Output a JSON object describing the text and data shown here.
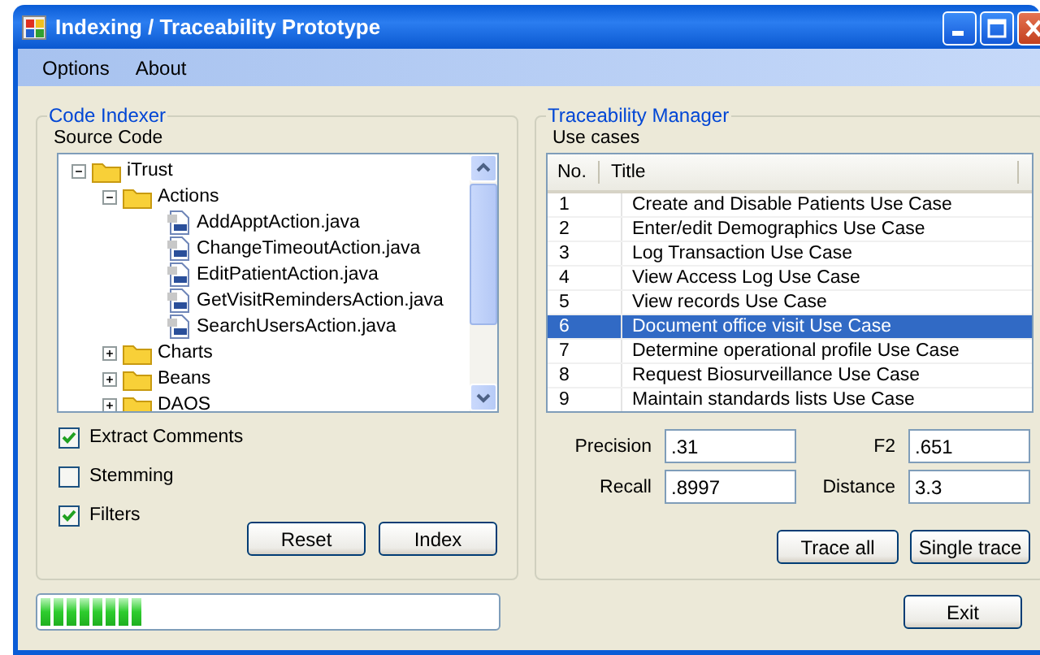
{
  "window": {
    "title": "Indexing / Traceability Prototype"
  },
  "menu": [
    "Options",
    "About"
  ],
  "code_indexer": {
    "title": "Code Indexer",
    "source_label": "Source Code",
    "tree": [
      {
        "label": "iTrust",
        "kind": "folder",
        "expanded": true,
        "children": [
          {
            "label": "Actions",
            "kind": "folder",
            "expanded": true,
            "children": [
              {
                "label": "AddApptAction.java",
                "kind": "file"
              },
              {
                "label": "ChangeTimeoutAction.java",
                "kind": "file"
              },
              {
                "label": "EditPatientAction.java",
                "kind": "file"
              },
              {
                "label": "GetVisitRemindersAction.java",
                "kind": "file"
              },
              {
                "label": "SearchUsersAction.java",
                "kind": "file"
              }
            ]
          },
          {
            "label": "Charts",
            "kind": "folder",
            "expanded": false
          },
          {
            "label": "Beans",
            "kind": "folder",
            "expanded": false
          },
          {
            "label": "DAOS",
            "kind": "folder",
            "expanded": false
          }
        ]
      }
    ],
    "options": [
      {
        "label": "Extract Comments",
        "checked": true
      },
      {
        "label": "Stemming",
        "checked": false
      },
      {
        "label": "Filters",
        "checked": true
      }
    ],
    "buttons": [
      "Reset",
      "Index"
    ]
  },
  "progress": {
    "level": 0.22
  },
  "traceability": {
    "title": "Traceability Manager",
    "list_label": "Use cases",
    "columns": [
      "No.",
      "Title"
    ],
    "rows": [
      {
        "no": "1",
        "title": "Create and Disable Patients Use Case",
        "selected": false
      },
      {
        "no": "2",
        "title": "Enter/edit Demographics Use Case",
        "selected": false
      },
      {
        "no": "3",
        "title": "Log Transaction Use Case",
        "selected": false
      },
      {
        "no": "4",
        "title": "View Access Log Use Case",
        "selected": false
      },
      {
        "no": "5",
        "title": "View records Use Case",
        "selected": false
      },
      {
        "no": "6",
        "title": "Document office visit Use Case",
        "selected": true
      },
      {
        "no": "7",
        "title": "Determine operational profile Use Case",
        "selected": false
      },
      {
        "no": "8",
        "title": "Request Biosurveillance Use Case",
        "selected": false
      },
      {
        "no": "9",
        "title": "Maintain standards lists Use Case",
        "selected": false
      }
    ],
    "metrics": [
      {
        "label": "Precision",
        "value": ".31"
      },
      {
        "label": "F2",
        "value": ".651"
      },
      {
        "label": "Recall",
        "value": ".8997"
      },
      {
        "label": "Distance",
        "value": "3.3"
      }
    ],
    "buttons": [
      "Trace all",
      "Single trace"
    ]
  },
  "exit_button": "Exit"
}
